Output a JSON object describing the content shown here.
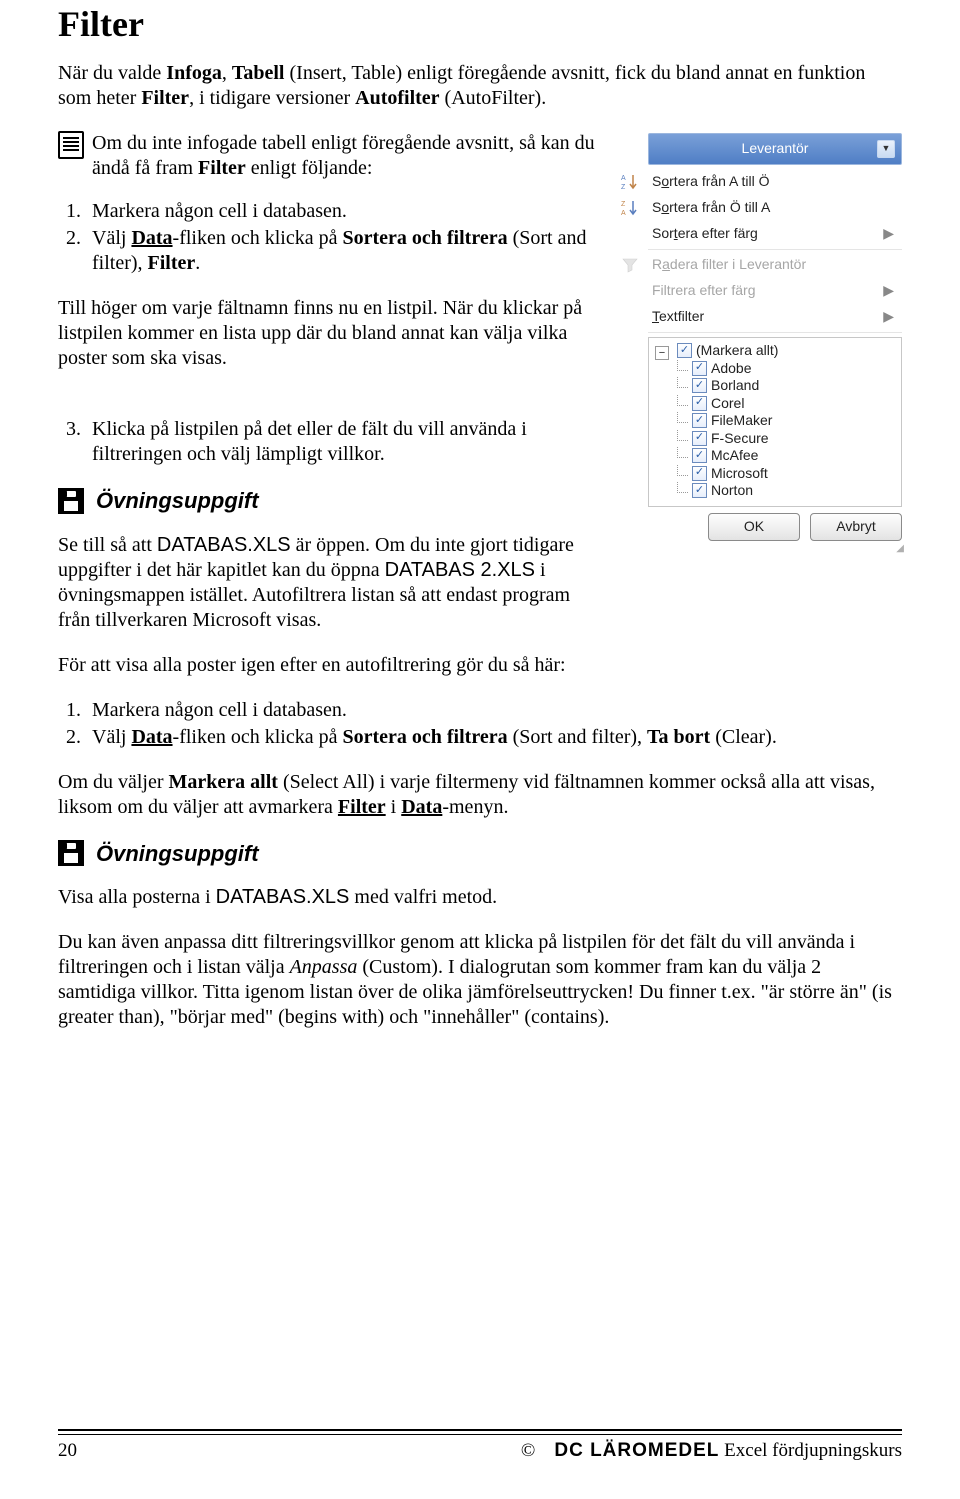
{
  "title": "Filter",
  "p1_pre": "När du valde ",
  "p1_b1": "Infoga",
  "p1_mid1": ", ",
  "p1_b2": "Tabell",
  "p1_mid2": " (Insert, Table) enligt föregående avsnitt, fick du bland annat en funktion som heter ",
  "p1_b3": "Filter",
  "p1_mid3": ", i tidigare versioner ",
  "p1_b4": "Autofilter",
  "p1_end": " (AutoFilter).",
  "note1_a": "Om du inte infogade tabell enligt föregående avsnitt, så kan du ändå få fram ",
  "note1_b": "Filter",
  "note1_c": " enligt följande:",
  "list1": {
    "i1": "Markera någon cell i databasen.",
    "i2_a": "Välj ",
    "i2_b": "Data",
    "i2_c": "-fliken och klicka på ",
    "i2_d": "Sortera och filtrera",
    "i2_e": " (Sort and filter), ",
    "i2_f": "Filter",
    "i2_g": "."
  },
  "p2": "Till höger om varje fältnamn finns nu en listpil. När du klickar på listpilen kommer en lista upp där du bland annat kan välja vilka poster som ska visas.",
  "list2": {
    "i3": "Klicka på listpilen på det eller de fält du vill använda i filtreringen och välj lämpligt villkor."
  },
  "exercise_label": "Övningsuppgift",
  "ex1_a": "Se till så att ",
  "ex1_b": "DATABAS.XLS",
  "ex1_c": " är öppen. Om du inte gjort tidigare uppgifter i det här kapitlet kan du öppna ",
  "ex1_d": "DATABAS 2.XLS",
  "ex1_e": " i övningsmappen istället. Autofiltrera listan så att endast program från tillverkaren Microsoft visas.",
  "p3": "För att visa alla poster igen efter en autofiltrering gör du så här:",
  "list3": {
    "i1": "Markera någon cell i databasen.",
    "i2_a": "Välj ",
    "i2_b": "Data",
    "i2_c": "-fliken och klicka på ",
    "i2_d": "Sortera och filtrera",
    "i2_e": " (Sort and filter), ",
    "i2_f": "Ta bort",
    "i2_g": " (Clear)."
  },
  "p4_a": "Om du väljer ",
  "p4_b": "Markera allt",
  "p4_c": " (Select All) i varje filtermeny vid fältnamnen kommer också alla att visas, liksom om du väljer att avmarkera ",
  "p4_d": "Filter",
  "p4_e": " i ",
  "p4_f": "Data",
  "p4_g": "-menyn.",
  "ex2_a": "Visa alla posterna i ",
  "ex2_b": "DATABAS.XLS",
  "ex2_c": " med valfri metod.",
  "p5_a": "Du kan även anpassa ditt filtreringsvillkor genom att klicka på listpilen för det fält du vill använda i filtreringen och i listan välja ",
  "p5_i": "Anpassa",
  "p5_b": " (Custom). I dialogrutan som kommer fram kan du välja 2 samtidiga villkor. Titta igenom listan över de olika jämförelseuttrycken! Du finner t.ex. \"är större än\" (is greater than), \"börjar med\" (begins with) och \"innehåller\" (contains).",
  "footer": {
    "page": "20",
    "copyright": "©",
    "brand": "DC  LÄROMEDEL",
    "course": "  Excel fördjupningskurs"
  },
  "widget": {
    "column_header": "Leverantör",
    "menu": {
      "sort_asc_pre": "S",
      "sort_asc_mid": "o",
      "sort_asc_rest": "rtera från A till Ö",
      "sort_desc_pre": "S",
      "sort_desc_mid": "o",
      "sort_desc_rest": "rtera från Ö till A",
      "sort_color_pre": "Sor",
      "sort_color_mid": "t",
      "sort_color_rest": "era efter färg",
      "clear_pre": "R",
      "clear_mid": "a",
      "clear_rest": "dera filter i Leverantör",
      "filter_color": "Filtrera efter färg",
      "text_filter": "Textfilter"
    },
    "tree": {
      "select_all": "(Markera allt)",
      "items": [
        "Adobe",
        "Borland",
        "Corel",
        "FileMaker",
        "F-Secure",
        "McAfee",
        "Microsoft",
        "Norton"
      ]
    },
    "buttons": {
      "ok": "OK",
      "cancel": "Avbryt"
    }
  }
}
